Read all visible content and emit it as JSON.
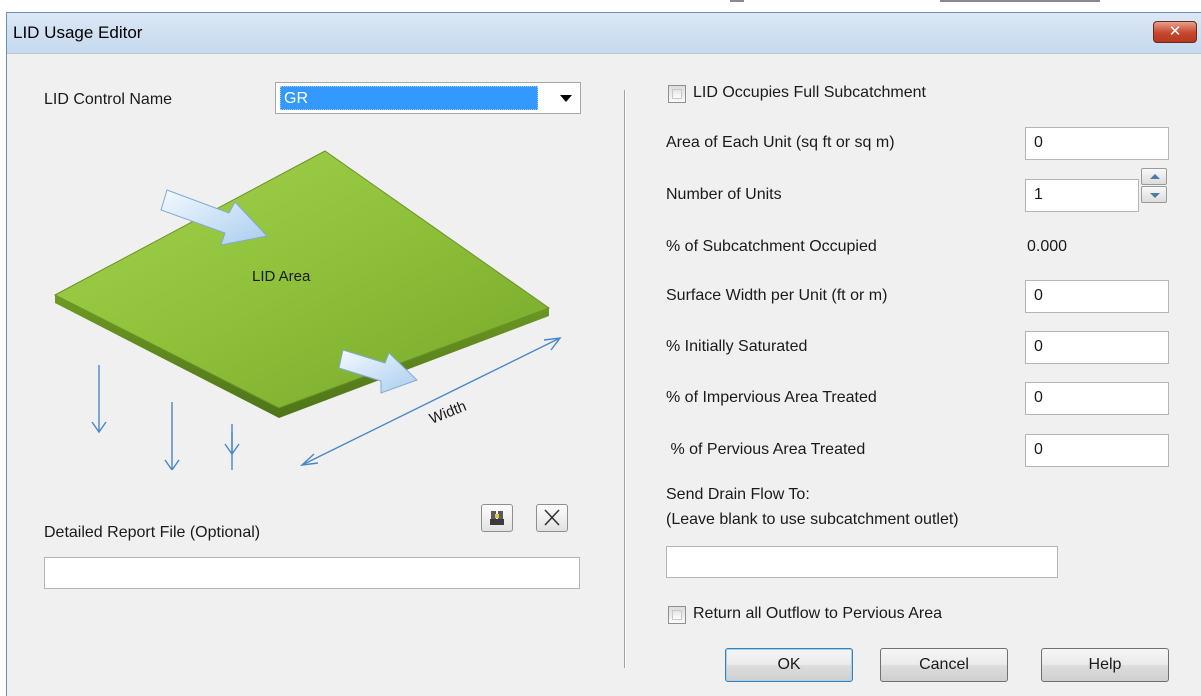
{
  "dialog": {
    "title": "LID Usage Editor",
    "close_label": "✕"
  },
  "left": {
    "control_name_label": "LID Control Name",
    "control_name_value": "GR",
    "diagram": {
      "area_label": "LID Area",
      "width_label": "Width"
    },
    "report_label": "Detailed Report File (Optional)",
    "report_value": ""
  },
  "right": {
    "full_subcatchment_label": "LID Occupies Full Subcatchment",
    "area_label": "Area of Each Unit (sq ft or sq m)",
    "area_value": "0",
    "units_label": "Number of Units",
    "units_value": "1",
    "occupied_label": "% of Subcatchment Occupied",
    "occupied_value": "0.000",
    "width_label": "Surface Width per Unit (ft or m)",
    "width_value": "0",
    "saturated_label": "% Initially Saturated",
    "saturated_value": "0",
    "impervious_label": "% of Impervious Area Treated",
    "impervious_value": "0",
    "pervious_label": " % of Pervious Area Treated",
    "pervious_value": "0",
    "drain_label_1": "Send Drain Flow To:",
    "drain_label_2": "(Leave blank to use subcatchment outlet)",
    "drain_value": "",
    "return_outflow_label": "Return all Outflow to Pervious Area"
  },
  "buttons": {
    "ok": "OK",
    "cancel": "Cancel",
    "help": "Help"
  },
  "colors": {
    "selection": "#3399ff",
    "area_fill": "#8ec03a",
    "arrow_blue": "#4a86c5"
  }
}
